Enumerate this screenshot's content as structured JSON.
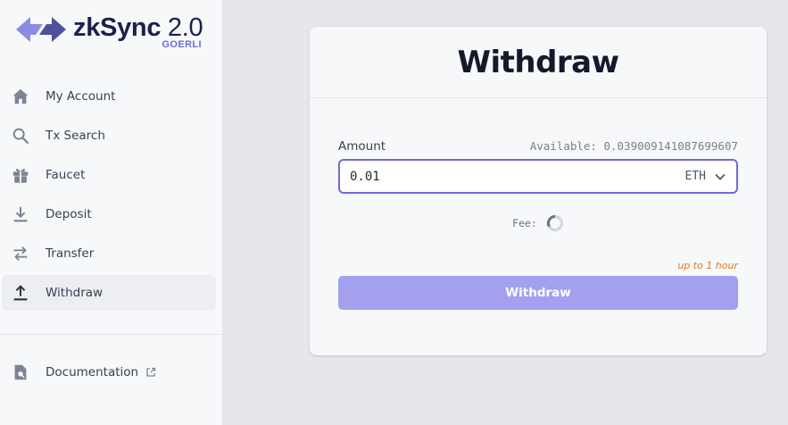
{
  "logo": {
    "brand": "zkSync",
    "version": "2.0",
    "network": "GOERLI",
    "brand_color": "#1e1f4a",
    "accent_color": "#6e6cd6"
  },
  "sidebar": {
    "items": [
      {
        "label": "My Account",
        "icon": "home-icon"
      },
      {
        "label": "Tx Search",
        "icon": "search-icon"
      },
      {
        "label": "Faucet",
        "icon": "gift-icon"
      },
      {
        "label": "Deposit",
        "icon": "download-icon"
      },
      {
        "label": "Transfer",
        "icon": "transfer-arrows-icon"
      },
      {
        "label": "Withdraw",
        "icon": "upload-icon",
        "active": true
      }
    ],
    "documentation": {
      "label": "Documentation",
      "icon": "document-icon",
      "external_icon": "external-link-icon"
    }
  },
  "withdraw": {
    "title": "Withdraw",
    "amount_label": "Amount",
    "available_text": "Available: 0.039009141087699607",
    "amount_value": "0.01",
    "token": "ETH",
    "fee_label": "Fee:",
    "time_hint": "up to 1 hour",
    "button_label": "Withdraw",
    "input_border_color": "#6d6bd8",
    "button_color": "#a3a1ee",
    "hint_color": "#e0781f"
  }
}
